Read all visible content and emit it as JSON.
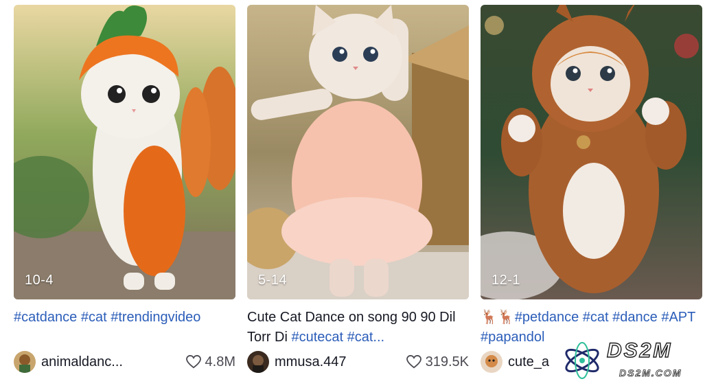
{
  "colors": {
    "hashtag": "#2b5db9",
    "text": "#161823",
    "muted": "#4a4a52"
  },
  "videos": [
    {
      "badge": "10-4",
      "caption": [
        {
          "text": "#catdance #cat",
          "tag": true
        },
        {
          "text": " ",
          "tag": false
        },
        {
          "text": "#trendingvideo",
          "tag": true
        }
      ],
      "author": "animaldanc...",
      "likes": "4.8M",
      "thumb_icon": "cat-carrot-costume-image"
    },
    {
      "badge": "5-14",
      "caption": [
        {
          "text": "Cute Cat Dance on song 90 90 Dil Torr Di ",
          "tag": false
        },
        {
          "text": "#cutecat #cat...",
          "tag": true
        }
      ],
      "author": "mmusa.447",
      "likes": "319.5K",
      "thumb_icon": "cat-pink-dress-image"
    },
    {
      "badge": "12-1",
      "caption": [
        {
          "text": "🦌🦌",
          "tag": false
        },
        {
          "text": "#petdance #cat #dance #APT #papandol",
          "tag": true
        }
      ],
      "author": "cute_a",
      "likes": "",
      "thumb_icon": "cat-reindeer-costume-image"
    }
  ],
  "watermark": {
    "title": "DS2M",
    "subtitle": "DS2M.COM"
  }
}
